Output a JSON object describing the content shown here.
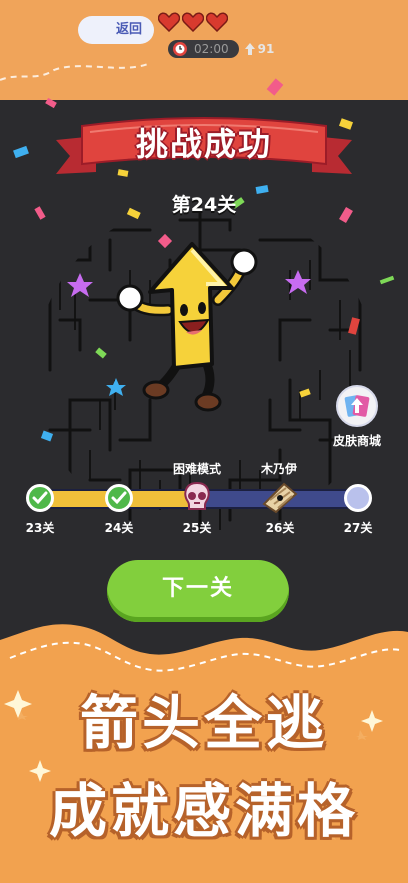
{
  "header": {
    "back_label": "返回",
    "timer": "02:00",
    "coins": "91",
    "lives": 3
  },
  "result": {
    "title": "挑战成功",
    "level": "第24关"
  },
  "shop": {
    "label": "皮肤商城"
  },
  "progress": {
    "fill": 0.5,
    "nodes": [
      {
        "label": "23关",
        "state": "done"
      },
      {
        "label": "24关",
        "state": "done"
      },
      {
        "label": "25关",
        "state": "skull",
        "tag": "困难模式"
      },
      {
        "label": "26关",
        "state": "reward",
        "tag": "木乃伊"
      },
      {
        "label": "27关",
        "state": "future"
      }
    ]
  },
  "actions": {
    "next_label": "下一关"
  },
  "promo": {
    "line1": "箭头全逃",
    "line2": "成就感满格"
  },
  "colors": {
    "header_orange": "#f0a45a",
    "ribbon_red": "#e0443e",
    "progress_gold": "#f0bf3a",
    "progress_blue": "#3f4a8c",
    "button_green": "#82cf3d",
    "banner_orange": "#f2a24f"
  }
}
